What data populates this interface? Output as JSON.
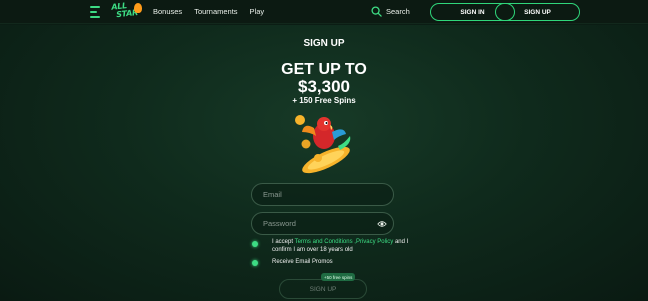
{
  "header": {
    "logo_line1": "ALL",
    "logo_line2": "STAR",
    "nav": [
      "Bonuses",
      "Tournaments",
      "Play"
    ],
    "search_label": "Search",
    "signin_label": "SIGN IN",
    "signup_label": "SIGN UP"
  },
  "main": {
    "title": "SIGN UP",
    "promo_line1": "GET UP TO",
    "promo_line2": "$3,300",
    "promo_line3": "+ 150 Free Spins"
  },
  "form": {
    "email_placeholder": "Email",
    "password_placeholder": "Password",
    "terms_prefix": "I accept ",
    "terms_link": "Terms and Conditions ,Privacy Policy",
    "terms_suffix": " and I confirm I am over 18 years old",
    "promos_label": "Receive Email Promos",
    "submit_label": "SIGN UP",
    "bonus_badge": "+50 free spins"
  },
  "colors": {
    "accent": "#3ddc84",
    "background": "#0b1d14"
  }
}
